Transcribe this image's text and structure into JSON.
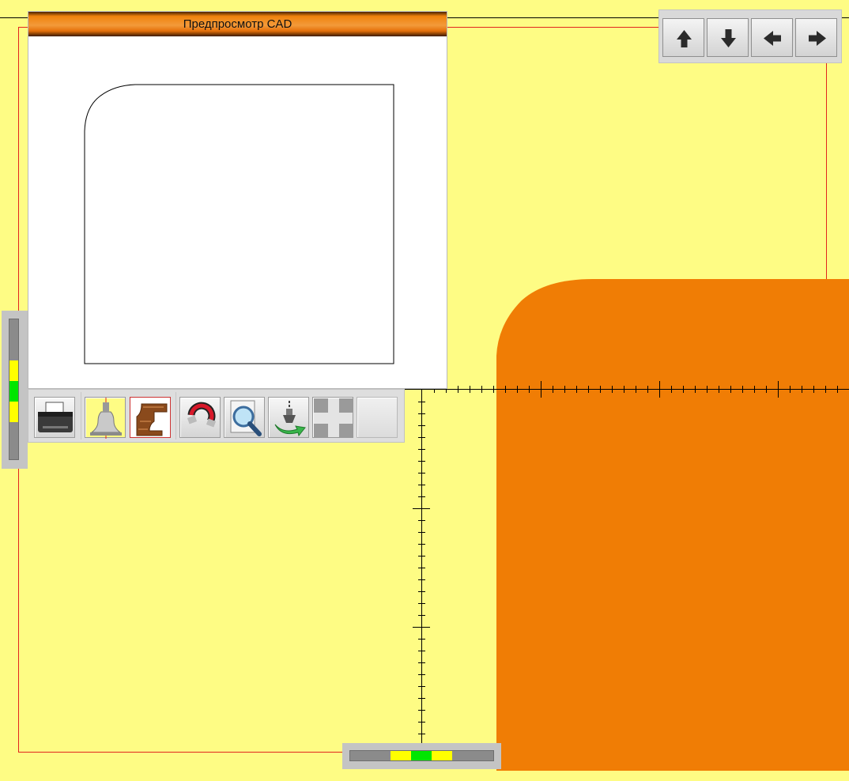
{
  "cad_preview": {
    "title": "Предпросмотр CAD"
  },
  "toolbar": {
    "buttons": [
      {
        "name": "print-button",
        "icon": "printer-icon"
      },
      {
        "name": "profile-view-button",
        "icon": "router-bit-profile-icon"
      },
      {
        "name": "wood-profile-button",
        "icon": "wood-profile-icon"
      },
      {
        "name": "snap-button",
        "icon": "magnet-icon"
      },
      {
        "name": "zoom-button",
        "icon": "magnifier-document-icon"
      },
      {
        "name": "tool-change-button",
        "icon": "router-tool-rotate-icon"
      },
      {
        "name": "move-center-button",
        "icon": "move-cross-icon"
      },
      {
        "name": "blank-button",
        "icon": "blank-icon"
      }
    ]
  },
  "navigation": {
    "buttons": [
      {
        "name": "nav-up-button",
        "icon": "arrow-up-icon"
      },
      {
        "name": "nav-down-button",
        "icon": "arrow-down-icon"
      },
      {
        "name": "nav-left-button",
        "icon": "arrow-left-icon"
      },
      {
        "name": "nav-right-button",
        "icon": "arrow-right-icon"
      }
    ]
  },
  "colors": {
    "background": "#fefc84",
    "workpiece": "#f07d05",
    "frame_line": "#e2251d",
    "indicator_yellow": "#ffff00",
    "indicator_green": "#00e600"
  }
}
